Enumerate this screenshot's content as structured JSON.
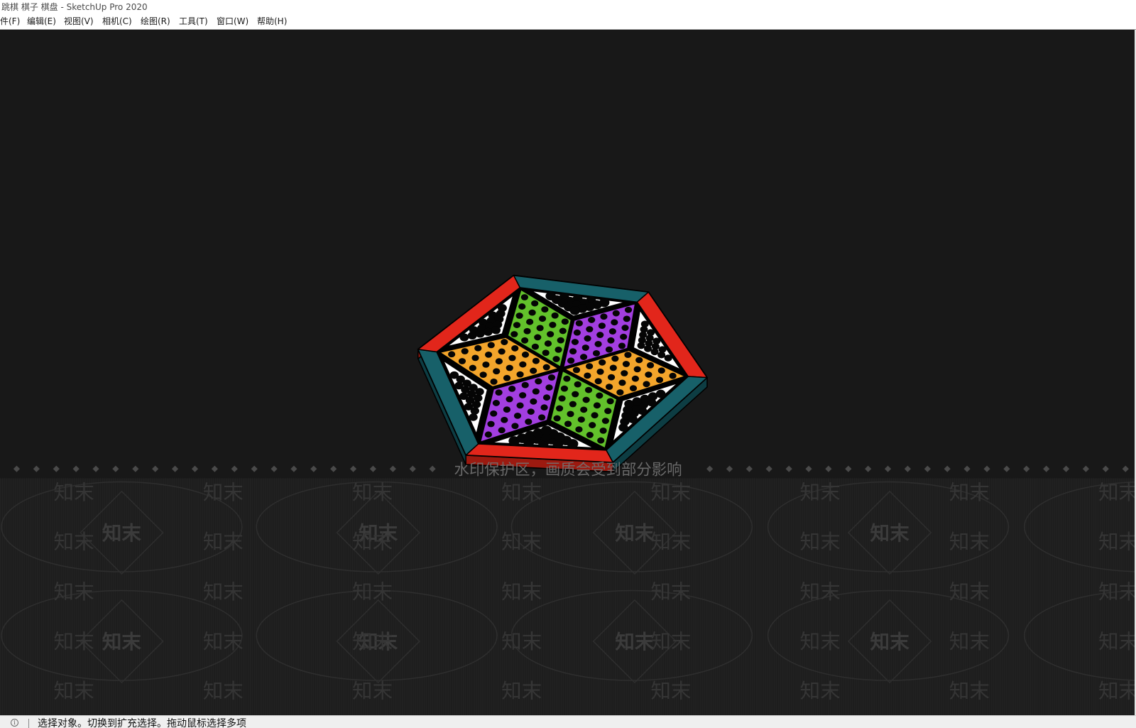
{
  "window": {
    "title": "跳棋 棋子 棋盘 - SketchUp Pro 2020"
  },
  "menu": {
    "items": [
      {
        "label": "件(F)"
      },
      {
        "label": "编辑(E)"
      },
      {
        "label": "视图(V)"
      },
      {
        "label": "相机(C)"
      },
      {
        "label": "绘图(R)"
      },
      {
        "label": "工具(T)"
      },
      {
        "label": "窗口(W)"
      },
      {
        "label": "帮助(H)"
      }
    ]
  },
  "watermark": {
    "notice": "水印保护区，画质会受到部分影响",
    "mark": "知末"
  },
  "status_bar": {
    "icon": "info-icon",
    "message": "选择对象。切换到扩充选择。拖动鼠标选择多项"
  },
  "colors": {
    "viewport_bg": "#181818",
    "frame_red": "#e2261b",
    "frame_teal": "#176069",
    "side_red": "#9c1a10",
    "side_teal": "#0d3d43",
    "arm_green": "#62c12b",
    "arm_purple": "#a23ee0",
    "arm_orange": "#f3a52b",
    "pocket": "#ffffff",
    "marble": "#050505",
    "hole": "#050505"
  }
}
